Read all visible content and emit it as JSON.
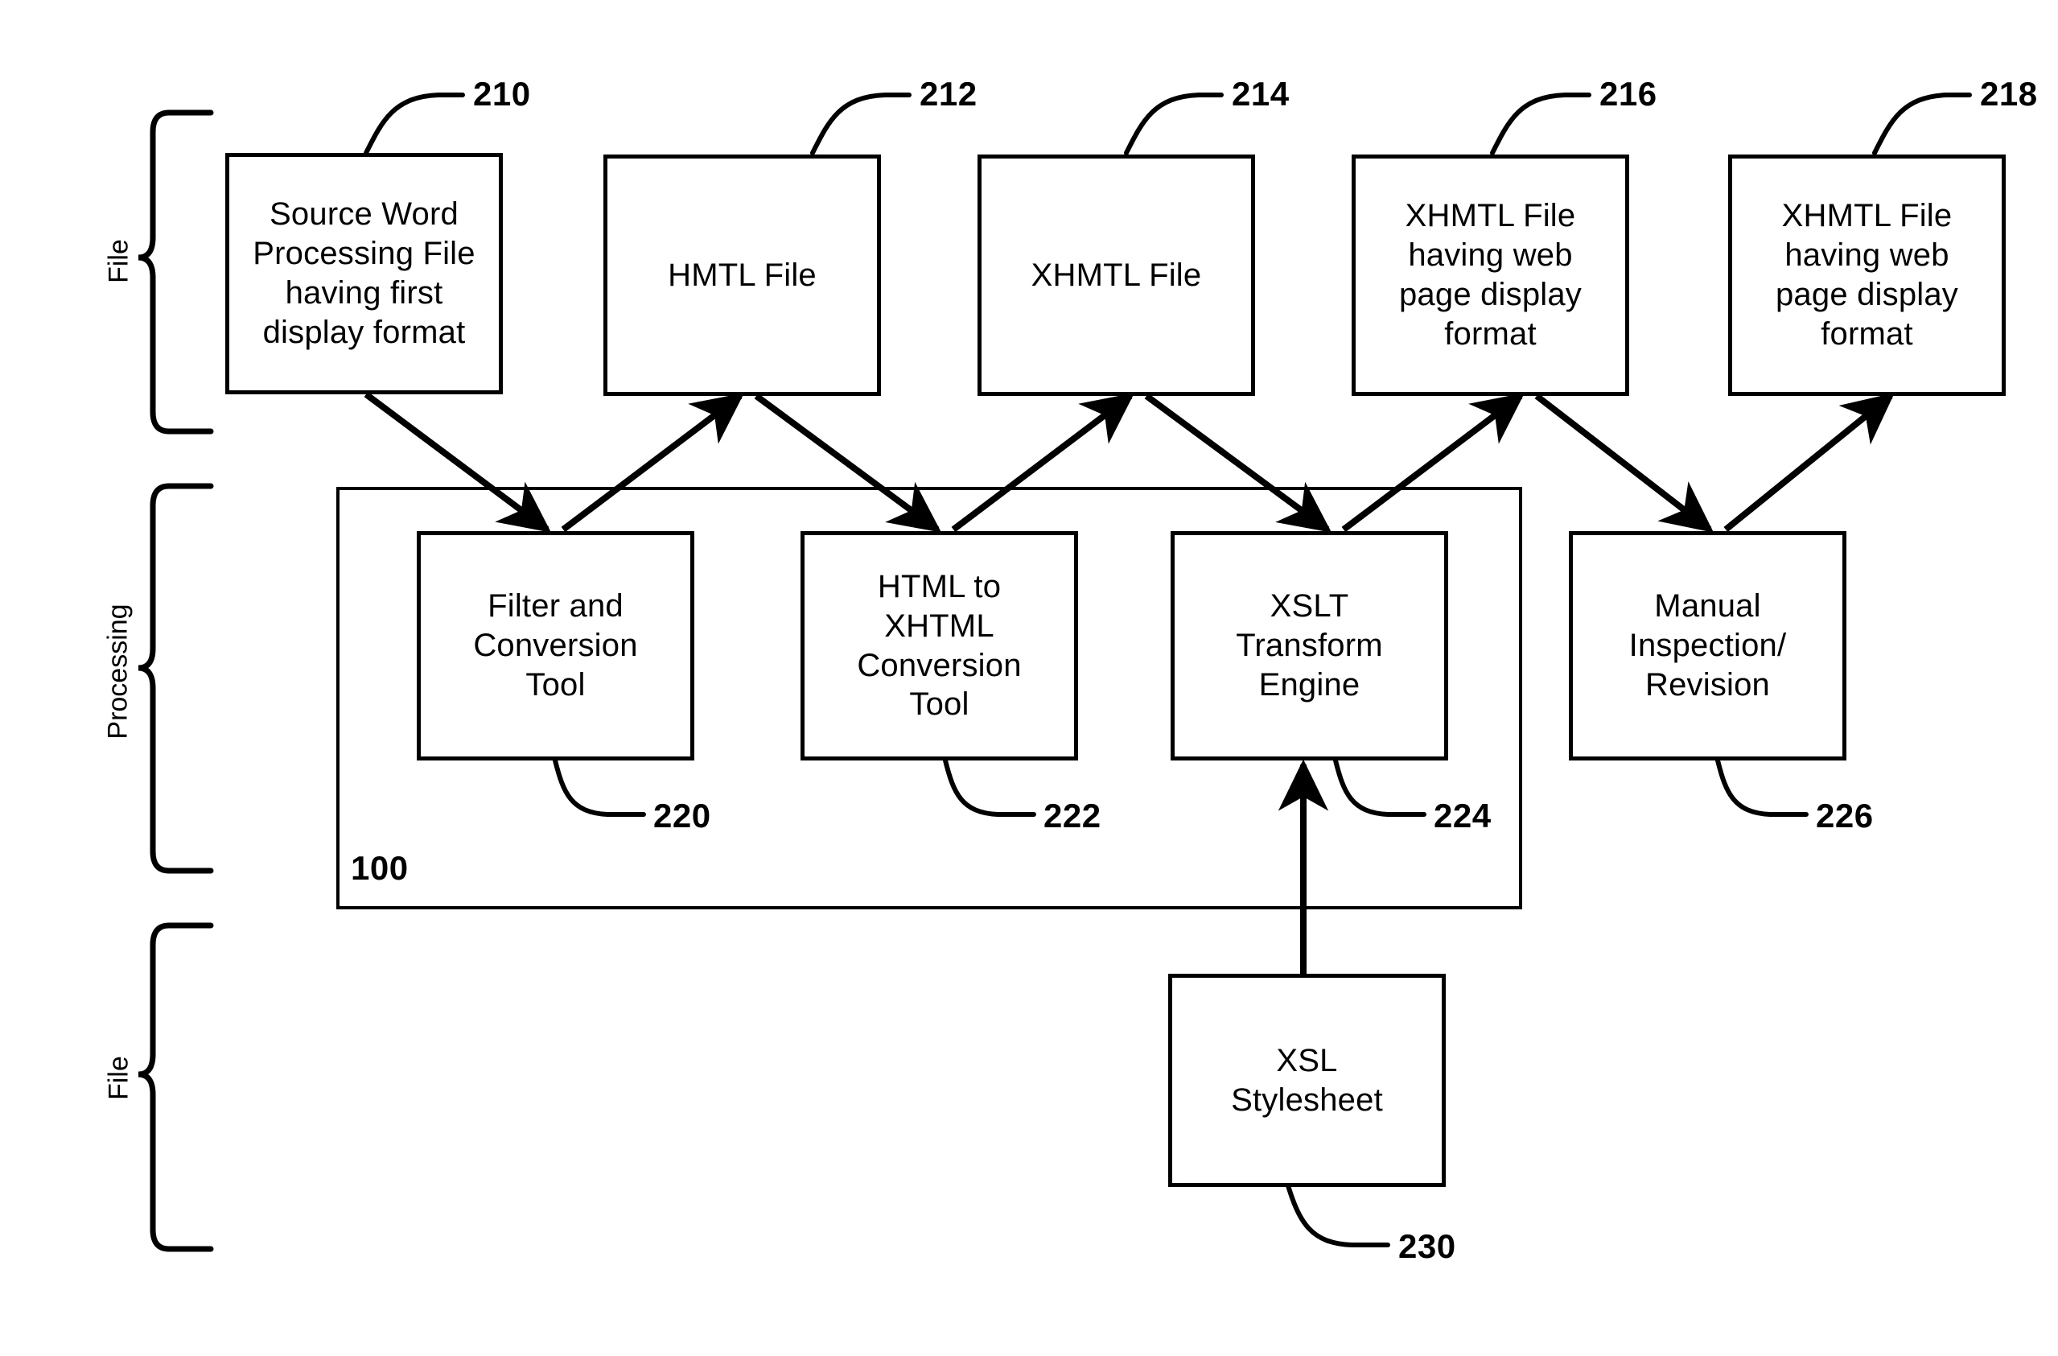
{
  "figure": {
    "type": "patent-flow-diagram",
    "system_label": "100"
  },
  "brackets": [
    {
      "id": "bracket-file-top",
      "label": "File"
    },
    {
      "id": "bracket-processing",
      "label": "Processing"
    },
    {
      "id": "bracket-file-bottom",
      "label": "File"
    }
  ],
  "file_row": [
    {
      "id": "source-word-processing-file",
      "ref": "210",
      "label": "Source Word\nProcessing File\nhaving first\ndisplay format"
    },
    {
      "id": "hmtl-file",
      "ref": "212",
      "label": "HMTL File"
    },
    {
      "id": "xhmtl-file",
      "ref": "214",
      "label": "XHMTL File"
    },
    {
      "id": "xhmtl-file-web-page-1",
      "ref": "216",
      "label": "XHMTL File\nhaving web\npage display\nformat"
    },
    {
      "id": "xhmtl-file-web-page-2",
      "ref": "218",
      "label": "XHMTL File\nhaving web\npage display\nformat"
    }
  ],
  "processing_row": [
    {
      "id": "filter-and-conversion-tool",
      "ref": "220",
      "label": "Filter and\nConversion\nTool"
    },
    {
      "id": "html-to-xhtml-conversion-tool",
      "ref": "222",
      "label": "HTML to\nXHTML\nConversion\nTool"
    },
    {
      "id": "xslt-transform-engine",
      "ref": "224",
      "label": "XSLT\nTransform\nEngine"
    },
    {
      "id": "manual-inspection-revision",
      "ref": "226",
      "label": "Manual\nInspection/\nRevision"
    }
  ],
  "stylesheet_row": [
    {
      "id": "xsl-stylesheet",
      "ref": "230",
      "label": "XSL\nStylesheet"
    }
  ],
  "colors": {
    "ink": "#000000",
    "paper": "#ffffff"
  }
}
